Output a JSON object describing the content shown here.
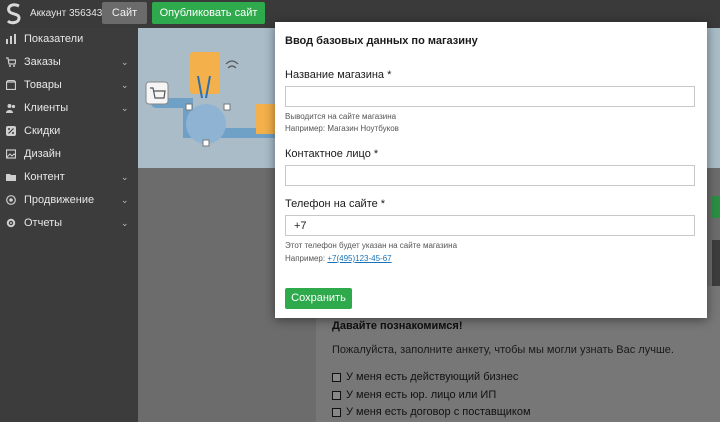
{
  "topbar": {
    "account": "Аккаунт 356343",
    "site_button": "Сайт",
    "publish_button": "Опубликовать сайт"
  },
  "sidebar": {
    "items": [
      {
        "label": "Показатели",
        "icon": "bar-chart-icon",
        "expandable": false
      },
      {
        "label": "Заказы",
        "icon": "cart-icon",
        "expandable": true
      },
      {
        "label": "Товары",
        "icon": "box-icon",
        "expandable": true
      },
      {
        "label": "Клиенты",
        "icon": "users-icon",
        "expandable": true
      },
      {
        "label": "Скидки",
        "icon": "percent-icon",
        "expandable": false
      },
      {
        "label": "Дизайн",
        "icon": "image-icon",
        "expandable": false
      },
      {
        "label": "Контент",
        "icon": "folder-icon",
        "expandable": true
      },
      {
        "label": "Продвижение",
        "icon": "target-icon",
        "expandable": true
      },
      {
        "label": "Отчеты",
        "icon": "gear-icon",
        "expandable": true
      }
    ]
  },
  "modal": {
    "title": "Ввод базовых данных по магазину",
    "store_name": {
      "label": "Название магазина *",
      "value": "",
      "hint_line1": "Выводится на сайте магазина",
      "hint_line2": "Например: Магазин Ноутбуков"
    },
    "contact": {
      "label": "Контактное лицо *",
      "value": ""
    },
    "phone": {
      "label": "Телефон на сайте *",
      "value": "+7",
      "hint_line1": "Этот телефон будет указан на сайте магазина",
      "hint_prefix": "Например:",
      "hint_example": "+7(495)123-45-67"
    },
    "save_button": "Сохранить"
  },
  "page": {
    "intro_title": "Давайте познакомимся!",
    "intro_text": "Пожалуйста, заполните анкету, чтобы мы могли узнать Вас лучше.",
    "checkboxes": [
      "У меня есть действующий бизнес",
      "У меня есть юр. лицо или ИП",
      "У меня есть договор с поставщиком"
    ]
  },
  "colors": {
    "accent_green": "#2eaa4c",
    "sidebar_bg": "#3c3c3c",
    "link_blue": "#1a73b8"
  }
}
